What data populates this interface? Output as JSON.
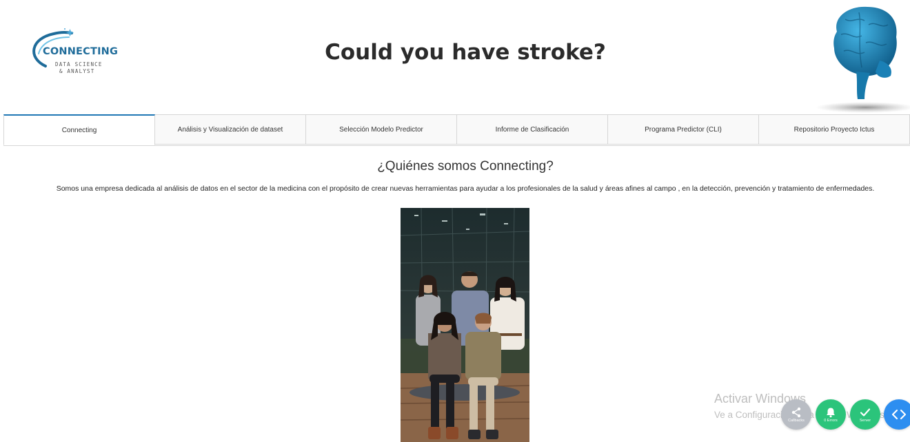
{
  "header": {
    "title": "Could you have stroke?",
    "logo": {
      "brand": "CONNECTING",
      "line1": "DATA SCIENCE",
      "line2": "& ANALYST"
    }
  },
  "tabs": [
    {
      "label": "Connecting",
      "active": true
    },
    {
      "label": "Análisis y Visualización de dataset",
      "active": false
    },
    {
      "label": "Selección Modelo Predictor",
      "active": false
    },
    {
      "label": "Informe de Clasificación",
      "active": false
    },
    {
      "label": "Programa Predictor (CLI)",
      "active": false
    },
    {
      "label": "Repositorio Proyecto Ictus",
      "active": false
    }
  ],
  "content": {
    "title": "¿Quiénes somos Connecting?",
    "description": "Somos una empresa dedicada al análisis de datos en el sector de la medicina con el propósito de crear nuevas herramientas para ayudar a los profesionales de la salud y áreas afines al campo , en la detección, prevención y tratamiento de enfermedades."
  },
  "watermark": {
    "line1": "Activar Windows",
    "line2": "Ve a Configuración para activar Windows."
  },
  "floating_buttons": [
    {
      "label": "Callbacks",
      "icon": "share-icon"
    },
    {
      "label": "0 Errors",
      "icon": "bell-icon"
    },
    {
      "label": "Server",
      "icon": "check-icon"
    },
    {
      "label": "",
      "icon": "code-icon"
    }
  ],
  "colors": {
    "accent": "#1f77b4",
    "logo": "#1f6c9a",
    "brain": "#1e8fc6",
    "fab_green": "#2bc47b",
    "fab_blue": "#2d8ef0",
    "fab_gray": "#b9bdc4"
  }
}
